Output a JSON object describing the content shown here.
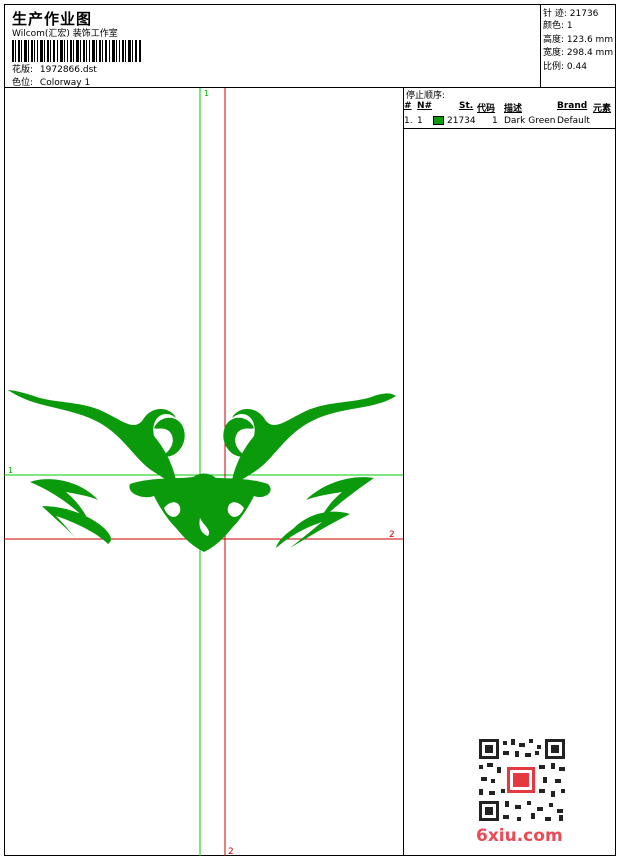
{
  "header": {
    "title": "生产作业图",
    "company": "Wilcom(汇宏) 装饰工作室",
    "design_label": "花版:",
    "design_value": "1972866.dst",
    "colorway_label": "色位:",
    "colorway_value": "Colorway 1"
  },
  "stats": [
    {
      "label": "针 迹:",
      "value": "21736"
    },
    {
      "label": "颜色:",
      "value": "1"
    },
    {
      "label": "高度:",
      "value": "123.6 mm"
    },
    {
      "label": "宽度:",
      "value": "298.4 mm"
    },
    {
      "label": "比例:",
      "value": "0.44"
    }
  ],
  "guides": {
    "green_vertical_label": "1",
    "green_horizontal_label": "1",
    "red_horizontal_label": "2",
    "red_vertical_label": "2",
    "green_color": "#00cc00",
    "red_color": "#cc0000"
  },
  "embroidery": {
    "color": "#0b9a0b",
    "shape": "tribal-wings-motif"
  },
  "stop_sequence": {
    "title": "停止顺序:",
    "headers": {
      "num": "#",
      "n": "N#",
      "st": "St.",
      "code": "代码",
      "desc": "描述",
      "brand": "Brand",
      "elem": "元素"
    },
    "rows": [
      {
        "num": "1.",
        "n": "1",
        "swatch_color": "#0b9a0b",
        "st": "21734",
        "code": "1",
        "desc": "Dark Green",
        "brand": "Default"
      }
    ]
  },
  "watermark": {
    "site": "6xiu.com",
    "qr_icon": "qr-code-icon"
  }
}
